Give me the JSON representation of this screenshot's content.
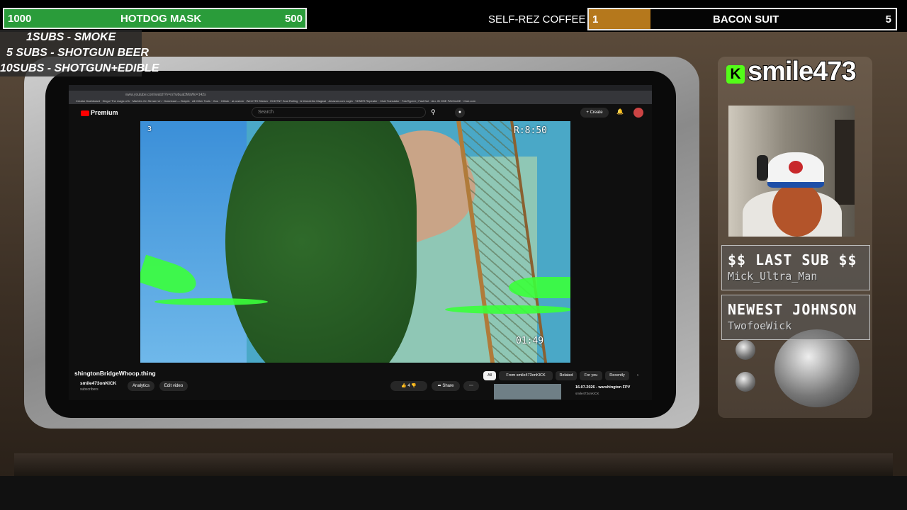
{
  "goals": {
    "hotdog": {
      "start": "1000",
      "label": "HOTDOG MASK",
      "end": "500"
    },
    "coffee": {
      "label": "SELF-REZ COFFEE GI"
    },
    "bacon": {
      "current": "1",
      "label": "BACON SUIT",
      "target": "5",
      "progress": 0.2
    }
  },
  "rewards": [
    "1SUBS   - SMOKE",
    "5 SUBS  - SHOTGUN BEER",
    "10SUBS - SHOTGUN+EDIBLE"
  ],
  "browser": {
    "url": "www.youtube.com/watch?v=rsTwbuaDMsWo=142s",
    "bookmarks": "Creator Dashboard · Kingu! The magic of k · Marbles On Stream Un · Download — Brayek · All Other Tools · Goo · Github · ai custom · WinCTRI Stream · ECDTNY Soul Rolling · A Wonderful Magical · Amazon.com Login · VENER Repeater · Chat Translator · FastTypeer | Fast Bot · ALL IN ONE PACKAGE · Club.com",
    "youtube": {
      "logo": "Premium",
      "search_placeholder": "Search",
      "create_label": "Create",
      "video_title": "shingtonBridgeWhoop.thing",
      "channel": "smile473onKICK",
      "subscribers": "subscribers",
      "analytics_label": "Analytics",
      "edit_label": "Edit video",
      "likes": "4",
      "share_label": "Share",
      "chips": [
        "All",
        "From smile473onKICK",
        "Related",
        "For you",
        "Recently"
      ],
      "recommendation": {
        "title": "16.07.2026 - warshington FPV",
        "channel": "smile473onKICK"
      }
    },
    "video_osd": {
      "top_left": "3",
      "top_right": "R:8:50",
      "bottom_right": "01:49"
    }
  },
  "brand": {
    "letter": "K",
    "name": "smile473"
  },
  "last_sub": {
    "title": "$$ LAST SUB $$",
    "name": "Mick_Ultra_Man"
  },
  "newest": {
    "title": "NEWEST JOHNSON",
    "name": "TwofoeWick"
  }
}
